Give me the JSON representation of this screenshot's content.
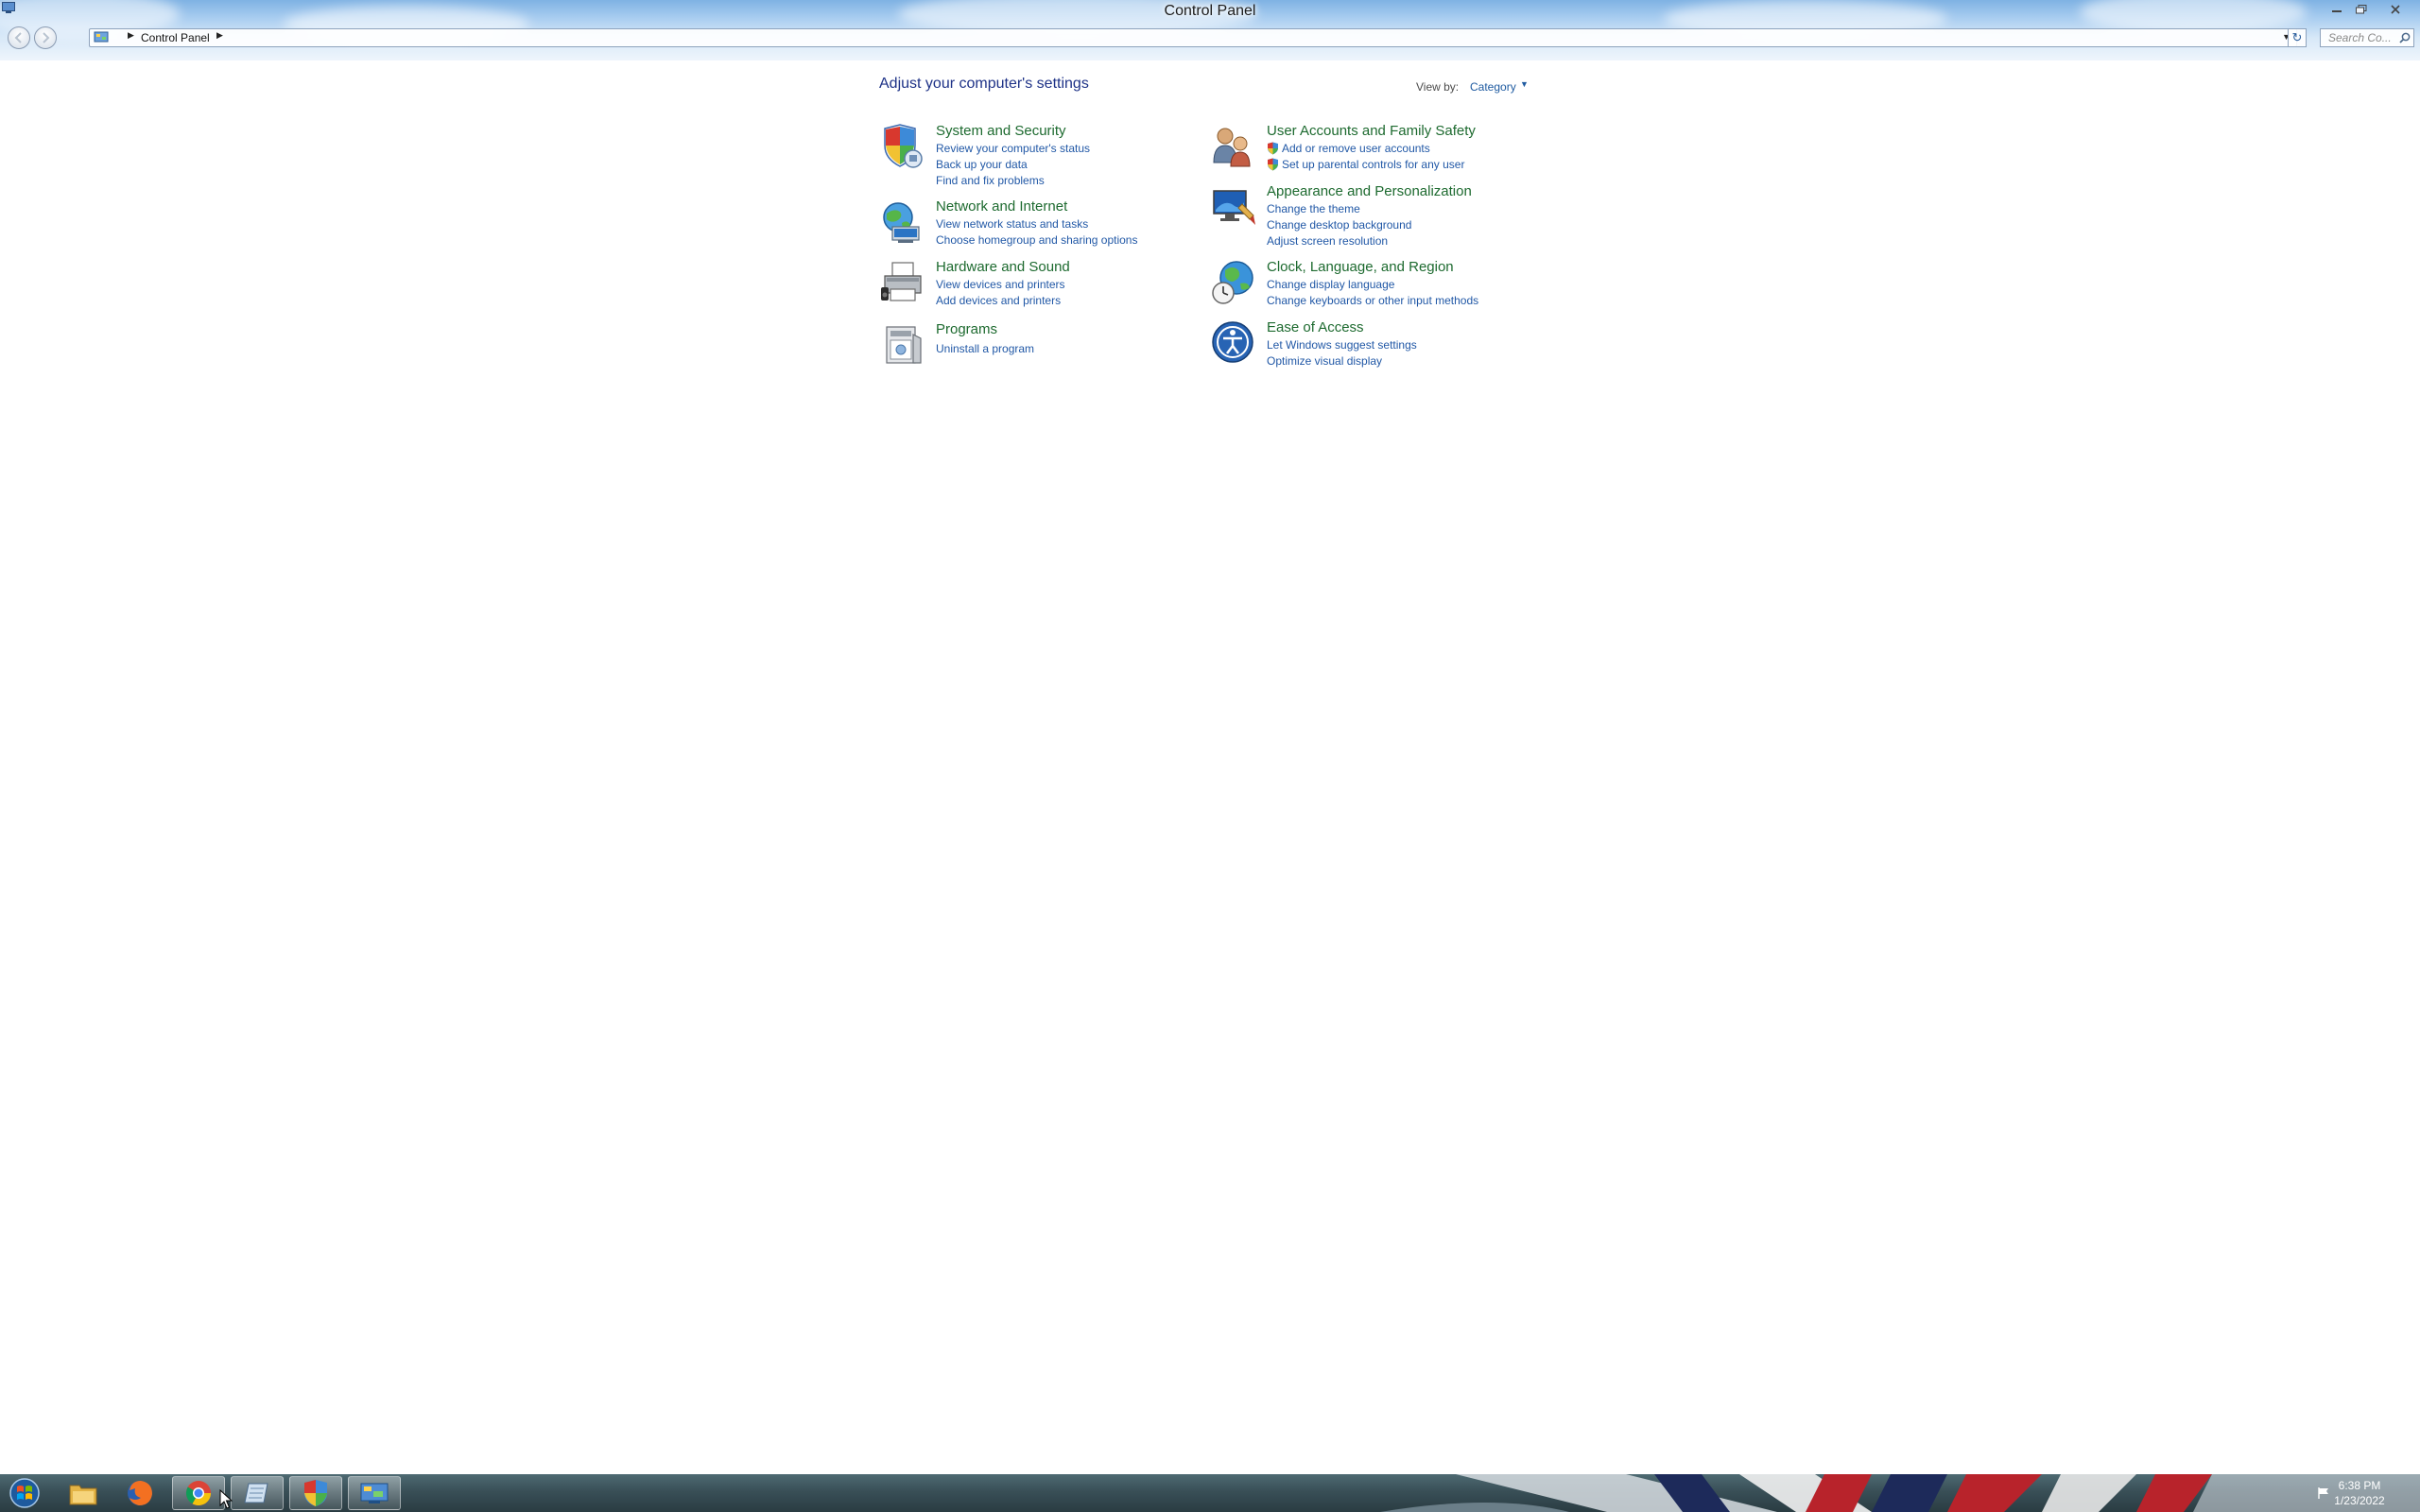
{
  "window": {
    "title": "Control Panel",
    "controls": {
      "minimize": "minimize",
      "maximize": "maximize",
      "close": "close"
    }
  },
  "address_bar": {
    "breadcrumb": "Control Panel",
    "search_placeholder": "Search Co..."
  },
  "content": {
    "heading": "Adjust your computer's settings",
    "view_by": {
      "label": "View by:",
      "value": "Category"
    },
    "categories": [
      {
        "title": "System and Security",
        "icon": "shield-icon",
        "links": [
          "Review your computer's status",
          "Back up your data",
          "Find and fix problems"
        ]
      },
      {
        "title": "Network and Internet",
        "icon": "network-globe-icon",
        "links": [
          "View network status and tasks",
          "Choose homegroup and sharing options"
        ]
      },
      {
        "title": "Hardware and Sound",
        "icon": "printer-icon",
        "links": [
          "View devices and printers",
          "Add devices and printers"
        ]
      },
      {
        "title": "Programs",
        "icon": "programs-box-icon",
        "links": [
          "Uninstall a program"
        ]
      },
      {
        "title": "User Accounts and Family Safety",
        "icon": "users-icon",
        "links": [
          "Add or remove user accounts",
          "Set up parental controls for any user"
        ]
      },
      {
        "title": "Appearance and Personalization",
        "icon": "display-brush-icon",
        "links": [
          "Change the theme",
          "Change desktop background",
          "Adjust screen resolution"
        ]
      },
      {
        "title": "Clock, Language, and Region",
        "icon": "globe-clock-icon",
        "links": [
          "Change display language",
          "Change keyboards or other input methods"
        ]
      },
      {
        "title": "Ease of Access",
        "icon": "accessibility-icon",
        "links": [
          "Let Windows suggest settings",
          "Optimize visual display"
        ]
      }
    ]
  },
  "taskbar": {
    "items": [
      "start-orb-icon",
      "file-explorer-icon",
      "firefox-icon",
      "chrome-icon",
      "notepad-icon",
      "security-shield-icon",
      "control-panel-icon"
    ],
    "time": "6:38 PM",
    "date": "1/23/2022"
  },
  "colors": {
    "category_title": "#1d6a2f",
    "link": "#2158a6",
    "heading": "#1e3287"
  }
}
